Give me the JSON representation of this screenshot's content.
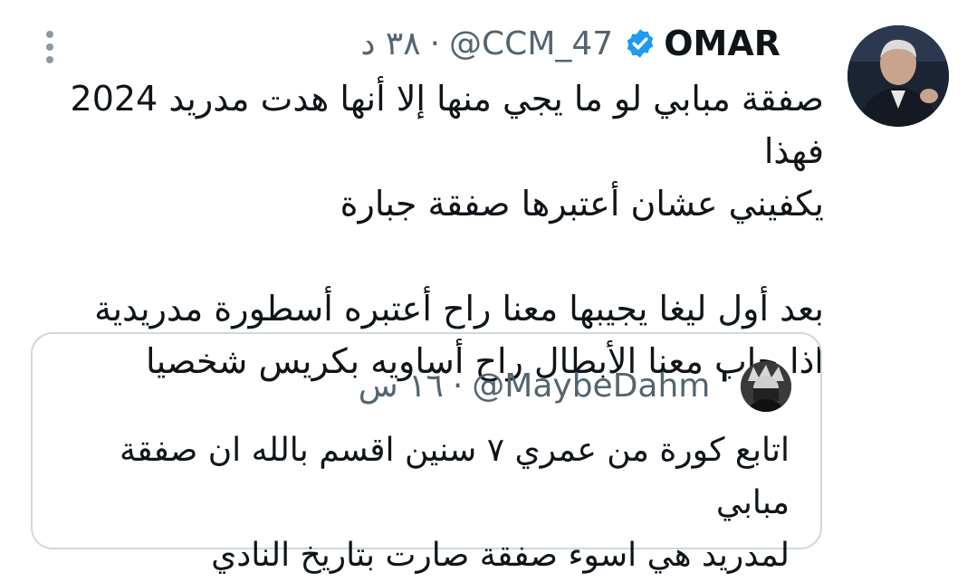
{
  "tweet": {
    "author": {
      "name": "OMAR",
      "verified": true,
      "handle": "@CCM_47",
      "separator": "·",
      "time": "٣٨ د"
    },
    "text": "صفقة مبابي لو ما يجي منها إلا أنها هدت مدريد 2024 فهذا\nيكفيني عشان أعتبرها صفقة جبارة\n\nبعد أول ليغا يجيبها معنا راح أعتبره أسطورة مدريدية\nاذا جاب معنا الأبطال راح أساويه بكريس شخصيا",
    "quoted": {
      "name": "'",
      "handle": "@MaybeDahm",
      "separator": "·",
      "time": "١٦ س",
      "text": "اتابع كورة من عمري ٧ سنين اقسم بالله ان صفقة مبابي\nلمدريد هي اسوء صفقة صارت بتاريخ النادي"
    },
    "icons": {
      "more": "more-vertical-icon",
      "verified": "verified-badge-icon"
    },
    "colors": {
      "verified": "#1d9bf0",
      "secondary_text": "#536471",
      "border": "#cfd9de"
    }
  }
}
